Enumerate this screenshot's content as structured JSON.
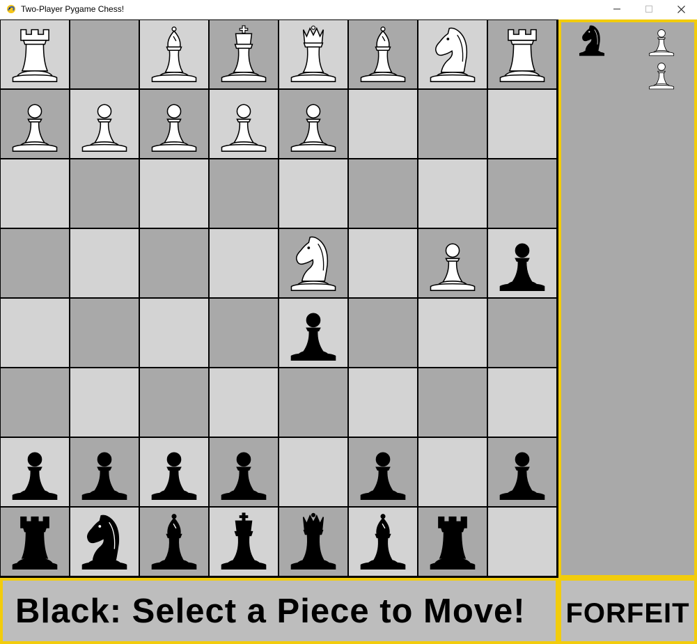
{
  "window": {
    "title": "Two-Player Pygame Chess!",
    "controls": [
      "minimize",
      "maximize",
      "close"
    ]
  },
  "colors": {
    "light_square": "#d3d3d3",
    "dark_square": "#a9a9a9",
    "highlight_border": "#f2cc0c",
    "panel_bg": "#a9a9a9",
    "status_bg": "#bdbdbd",
    "white_piece": "#ffffff",
    "black_piece": "#000000"
  },
  "board": {
    "rows": [
      [
        "wR",
        "",
        "wB",
        "wK",
        "wQ",
        "wB",
        "wN",
        "wR"
      ],
      [
        "wP",
        "wP",
        "wP",
        "wP",
        "wP",
        "",
        "",
        ""
      ],
      [
        "",
        "",
        "",
        "",
        "",
        "",
        "",
        ""
      ],
      [
        "",
        "",
        "",
        "",
        "wN",
        "",
        "wP",
        "bP"
      ],
      [
        "",
        "",
        "",
        "",
        "bP",
        "",
        "",
        ""
      ],
      [
        "",
        "",
        "",
        "",
        "",
        "",
        "",
        ""
      ],
      [
        "bP",
        "bP",
        "bP",
        "bP",
        "",
        "bP",
        "",
        "bP"
      ],
      [
        "bR",
        "bN",
        "bB",
        "bK",
        "bQ",
        "bB",
        "bR",
        ""
      ]
    ]
  },
  "captured": {
    "by_white": [
      "bN"
    ],
    "by_black": [
      "wP",
      "wP"
    ]
  },
  "status": {
    "message": "Black: Select a Piece to Move!"
  },
  "forfeit": {
    "label": "FORFEIT"
  }
}
